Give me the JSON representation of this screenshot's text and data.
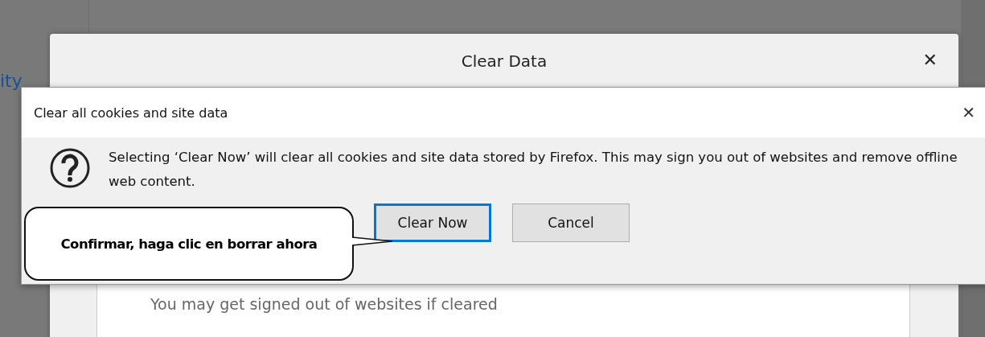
{
  "background_page": {
    "link_fragment": "ity"
  },
  "back_dialog": {
    "title": "Clear Data",
    "close": "✕",
    "note": "You may get signed out of websites if cleared"
  },
  "dialog": {
    "title": "Clear all cookies and site data",
    "close": "✕",
    "message": "Selecting ‘Clear Now’ will clear all cookies and site data stored by Firefox. This may sign you out of websites and remove offline web content.",
    "buttons": [
      {
        "label": "Clear Now",
        "focused": true
      },
      {
        "label": "Cancel",
        "focused": false
      }
    ]
  },
  "callout": {
    "text": "Confirmar, haga clic en borrar ahora"
  }
}
